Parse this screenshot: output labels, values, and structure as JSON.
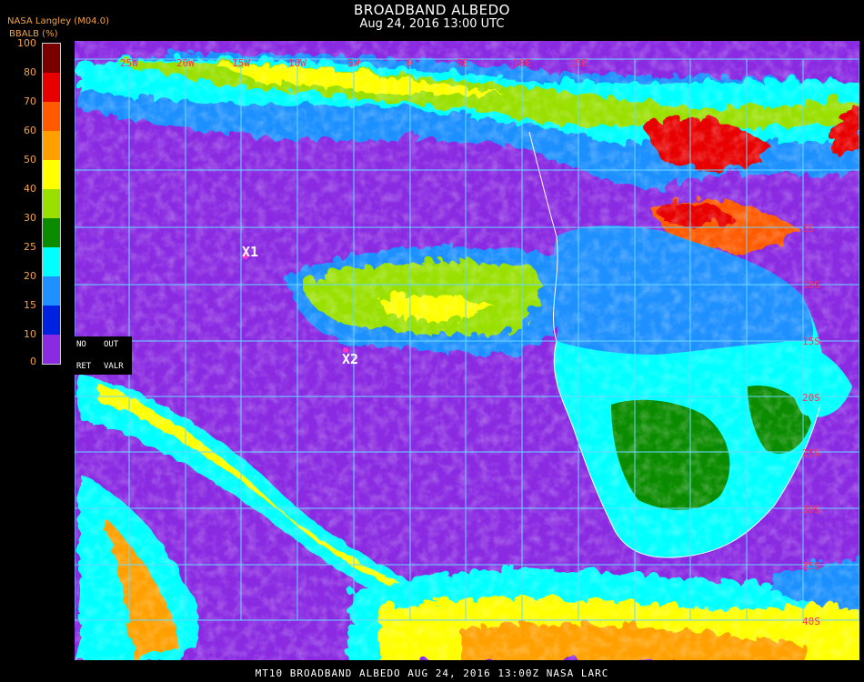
{
  "title": "BROADBAND ALBEDO",
  "datetime": "Aug 24, 2016 13:00 UTC",
  "source": "NASA Langley (M04.0)",
  "variable_label": "BBALB (%)",
  "colorbar": {
    "ticks": [
      "100",
      "80",
      "70",
      "60",
      "50",
      "40",
      "30",
      "25",
      "20",
      "15",
      "10",
      "0"
    ],
    "colors": [
      "#7a0000",
      "#e80000",
      "#ff5a00",
      "#ffa000",
      "#ffff00",
      "#99e000",
      "#0b8c00",
      "#00ffff",
      "#1e90ff",
      "#0022e0",
      "#8a2be2"
    ]
  },
  "legend_key": {
    "no": "NO",
    "out": "OUT",
    "ret": "RET",
    "valr": "VALR"
  },
  "lon_labels": [
    "25W",
    "20W",
    "15W",
    "10W",
    "5W",
    "0",
    "5E",
    "10E",
    "15E"
  ],
  "lat_labels": [
    "5S",
    "10S",
    "15S",
    "20S",
    "25S",
    "30S",
    "35S",
    "40S"
  ],
  "markers": [
    {
      "label": "X1"
    },
    {
      "label": "X2"
    }
  ],
  "footer": "MT10  BROADBAND ALBEDO   AUG 24, 2016 13:00Z   NASA LARC"
}
